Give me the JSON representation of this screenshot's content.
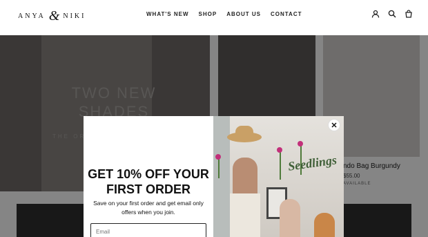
{
  "header": {
    "logo_left": "ANYA",
    "logo_amp": "&",
    "logo_right": "NIKI",
    "nav": [
      {
        "label": "WHAT'S NEW"
      },
      {
        "label": "SHOP"
      },
      {
        "label": "ABOUT US"
      },
      {
        "label": "CONTACT"
      }
    ],
    "icons": [
      "account-icon",
      "search-icon",
      "cart-icon"
    ]
  },
  "background": {
    "hero_title": "TWO NEW SHADES",
    "hero_subtitle": "THE ORIG",
    "product_name": "ndo Bag Burgundy",
    "product_price": "$55.00",
    "product_tag": "AVAILABLE"
  },
  "popup": {
    "title": "GET 10% OFF YOUR FIRST ORDER",
    "text": "Save on your first order and get email only offers when you join.",
    "email_placeholder": "Email",
    "image_sign": "Seedlings",
    "close_icon": "close-icon"
  },
  "colors": {
    "overlay": "#000000",
    "accent": "#111111"
  }
}
